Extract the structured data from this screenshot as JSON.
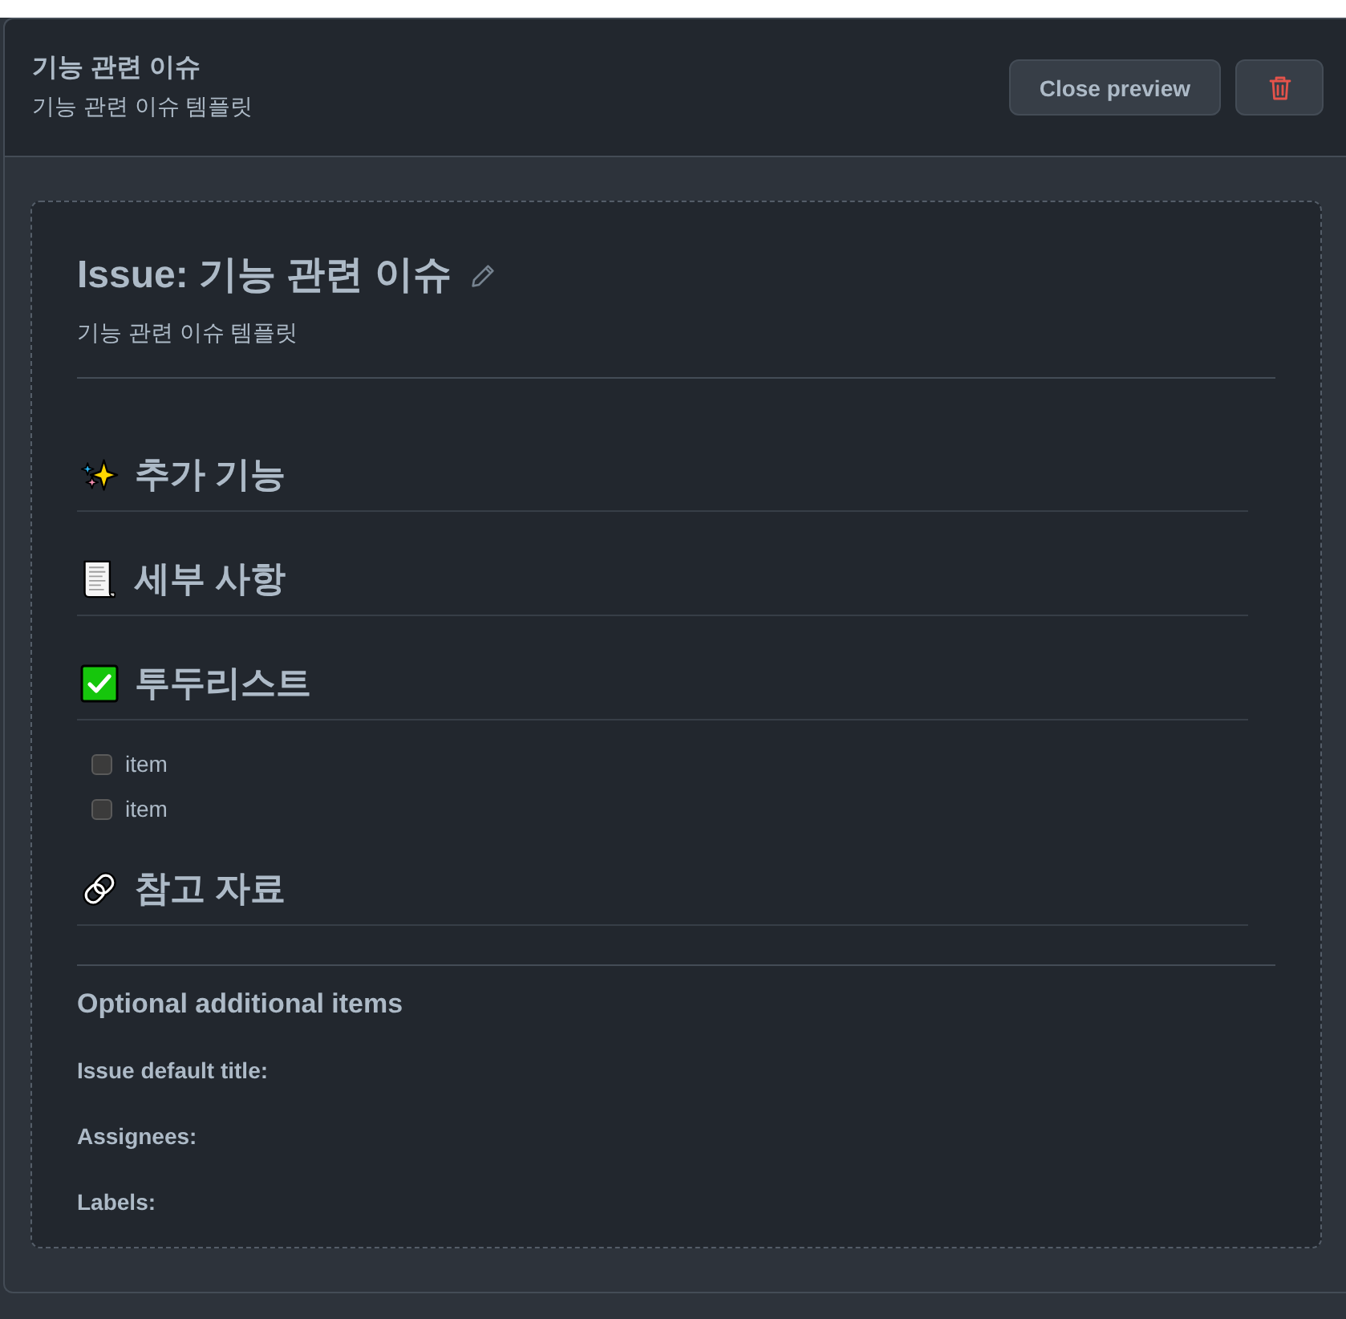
{
  "header": {
    "title": "기능 관련 이슈",
    "subtitle": "기능 관련 이슈 템플릿",
    "close_button": "Close preview"
  },
  "preview": {
    "title": "Issue: 기능 관련 이슈",
    "description": "기능 관련 이슈 템플릿",
    "sections": [
      {
        "heading": "추가 기능"
      },
      {
        "heading": "세부 사항"
      },
      {
        "heading": "투두리스트",
        "items": [
          {
            "label": "item",
            "checked": false
          },
          {
            "label": "item",
            "checked": false
          }
        ]
      },
      {
        "heading": "참고 자료"
      }
    ]
  },
  "optional": {
    "title": "Optional additional items",
    "fields": [
      "Issue default title:",
      "Assignees:",
      "Labels:"
    ]
  }
}
